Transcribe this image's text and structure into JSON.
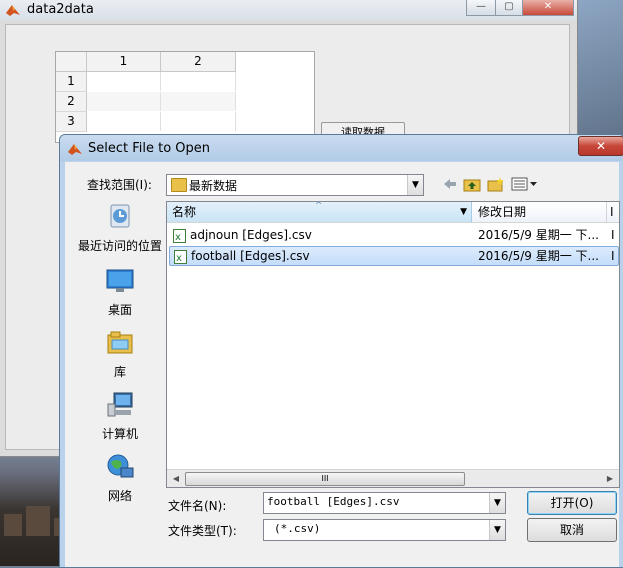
{
  "figure": {
    "title": "data2data",
    "window_buttons": [
      "—",
      "▢",
      "✕"
    ],
    "table": {
      "columns": [
        "1",
        "2"
      ],
      "rows": [
        "1",
        "2",
        "3"
      ]
    },
    "read_button_label": "读取数据"
  },
  "dialog": {
    "title": "Select File to Open",
    "close_label": "✕",
    "lookin_label": "查找范围(I):",
    "lookin_value": "最新数据",
    "places": [
      {
        "label": "最近访问的位置",
        "icon": "recent-places-icon"
      },
      {
        "label": "桌面",
        "icon": "desktop-icon"
      },
      {
        "label": "库",
        "icon": "libraries-icon"
      },
      {
        "label": "计算机",
        "icon": "computer-icon"
      },
      {
        "label": "网络",
        "icon": "network-icon"
      }
    ],
    "columns": {
      "name": "名称",
      "date": "修改日期",
      "extra": "I"
    },
    "files": [
      {
        "name": "adjnoun [Edges].csv",
        "date": "2016/5/9 星期一 下...",
        "extra": "I",
        "selected": false
      },
      {
        "name": "football [Edges].csv",
        "date": "2016/5/9 星期一 下...",
        "extra": "I",
        "selected": true
      }
    ],
    "filename_label": "文件名(N):",
    "filename_value": "football [Edges].csv",
    "filetype_label": "文件类型(T):",
    "filetype_value": "(*.csv)",
    "open_label": "打开(O)",
    "cancel_label": "取消",
    "scroll_thumb": "III"
  }
}
